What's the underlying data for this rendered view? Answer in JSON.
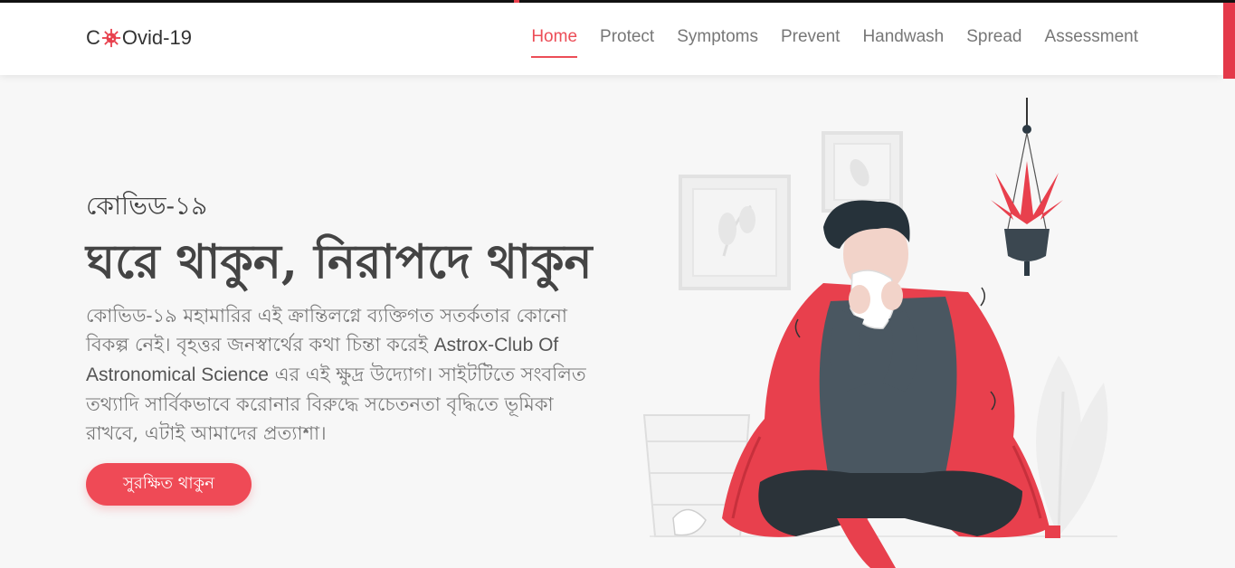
{
  "logo": {
    "prefix": "C",
    "suffix": "Ovid-19"
  },
  "nav": [
    {
      "label": "Home",
      "active": true
    },
    {
      "label": "Protect",
      "active": false
    },
    {
      "label": "Symptoms",
      "active": false
    },
    {
      "label": "Prevent",
      "active": false
    },
    {
      "label": "Handwash",
      "active": false
    },
    {
      "label": "Spread",
      "active": false
    },
    {
      "label": "Assessment",
      "active": false
    }
  ],
  "hero": {
    "subtitle": "কোভিড-১৯",
    "title": "ঘরে থাকুন, নিরাপদে থাকুন",
    "body_pre": "কোভিড-১৯ মহামারির এই ক্রান্তিলগ্নে ব্যক্তিগত সতর্কতার কোনো বিকল্প নেই। বৃহত্তর জনস্বার্থের কথা চিন্তা করেই ",
    "body_highlight": "Astrox-Club Of Astronomical Science",
    "body_post": " এর এই ক্ষুদ্র উদ্যোগ। সাইটটিতে সংবলিত তথ্যাদি সার্বিকভাবে করোনার বিরুদ্ধে সচেতনতা বৃদ্ধিতে ভূমিকা রাখবে, এটাই আমাদের প্রত্যাশা।",
    "cta_label": "সুরক্ষিত থাকুন"
  },
  "colors": {
    "accent": "#ef4a56",
    "text": "#444444",
    "muted": "#777777"
  },
  "icons": {
    "logo_virus": "virus-icon",
    "illustration": "sick-man-sneezing-illustration"
  }
}
